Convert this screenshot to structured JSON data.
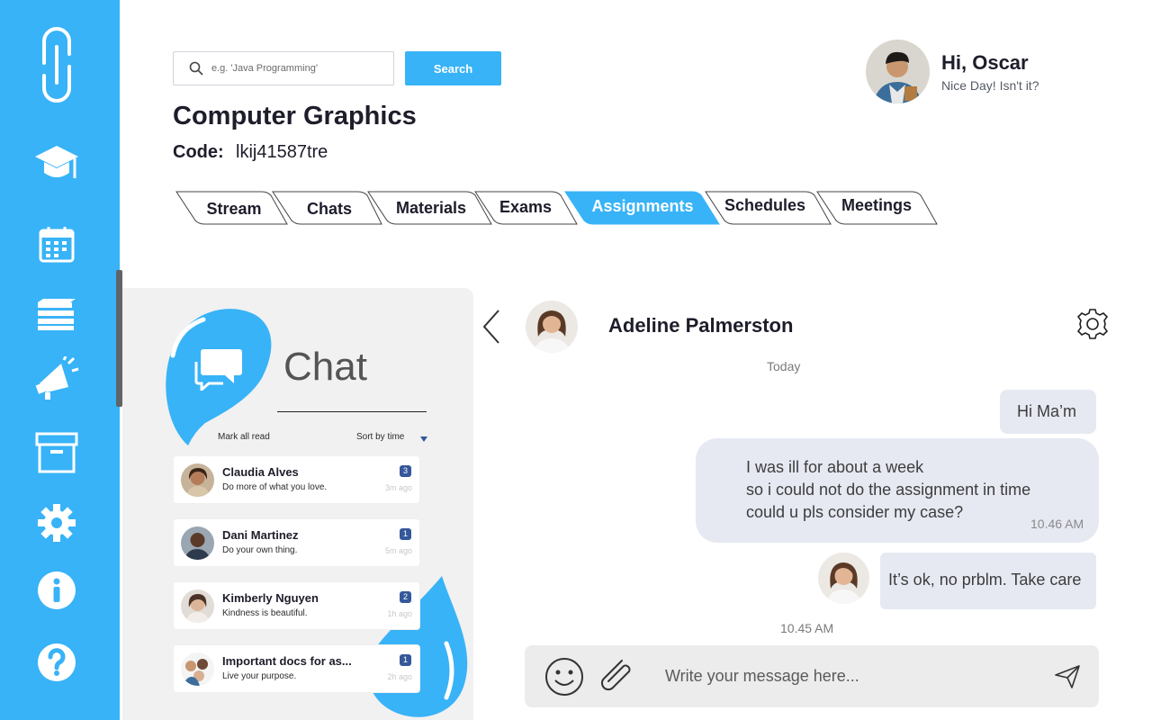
{
  "colors": {
    "accent": "#38b3f7",
    "badge": "#35589a",
    "bubble": "#e6e9f2",
    "panel": "#f1f1f1"
  },
  "sidebar": {
    "items": [
      {
        "icon": "link-logo-icon"
      },
      {
        "icon": "graduation-cap-icon"
      },
      {
        "icon": "calendar-icon"
      },
      {
        "icon": "stack-layers-icon"
      },
      {
        "icon": "megaphone-icon"
      },
      {
        "icon": "archive-box-icon"
      },
      {
        "icon": "gear-icon"
      },
      {
        "icon": "info-icon"
      },
      {
        "icon": "help-icon"
      }
    ]
  },
  "search": {
    "placeholder": "e.g. 'Java Programming'",
    "button_label": "Search"
  },
  "user": {
    "greeting": "Hi, Oscar",
    "subtitle": "Nice Day! Isn't it?"
  },
  "course": {
    "title": "Computer Graphics",
    "code_label": "Code:",
    "code_value": "lkij41587tre"
  },
  "tabs": [
    {
      "label": "Stream",
      "active": false
    },
    {
      "label": "Chats",
      "active": false
    },
    {
      "label": "Materials",
      "active": false
    },
    {
      "label": "Exams",
      "active": false
    },
    {
      "label": "Assignments",
      "active": true
    },
    {
      "label": "Schedules",
      "active": false
    },
    {
      "label": "Meetings",
      "active": false
    }
  ],
  "chat_list": {
    "heading": "Chat",
    "mark_all_read": "Mark all read",
    "sort_label": "Sort by time",
    "contacts": [
      {
        "name": "Claudia Alves",
        "message": "Do more of what you love.",
        "badge": "3",
        "time": "3m ago"
      },
      {
        "name": "Dani Martinez",
        "message": "Do your own thing.",
        "badge": "1",
        "time": "5m ago"
      },
      {
        "name": "Kimberly Nguyen",
        "message": "Kindness is beautiful.",
        "badge": "2",
        "time": "1h ago"
      },
      {
        "name": "Important docs for as...",
        "message": "Live your purpose.",
        "badge": "1",
        "time": "2h ago"
      }
    ]
  },
  "conversation": {
    "name": "Adeline Palmerston",
    "day": "Today",
    "messages": [
      {
        "from": "me",
        "text": "Hi Ma’m"
      },
      {
        "from": "me",
        "lines": [
          "I was ill for about a week",
          "so i could not do the assignment in time",
          "could u pls consider my case?"
        ],
        "time": "10.46 AM"
      },
      {
        "from": "them",
        "text": "It’s ok, no prblm. Take care",
        "time": "10.45 AM"
      }
    ]
  },
  "composer": {
    "placeholder": "Write your message here..."
  }
}
